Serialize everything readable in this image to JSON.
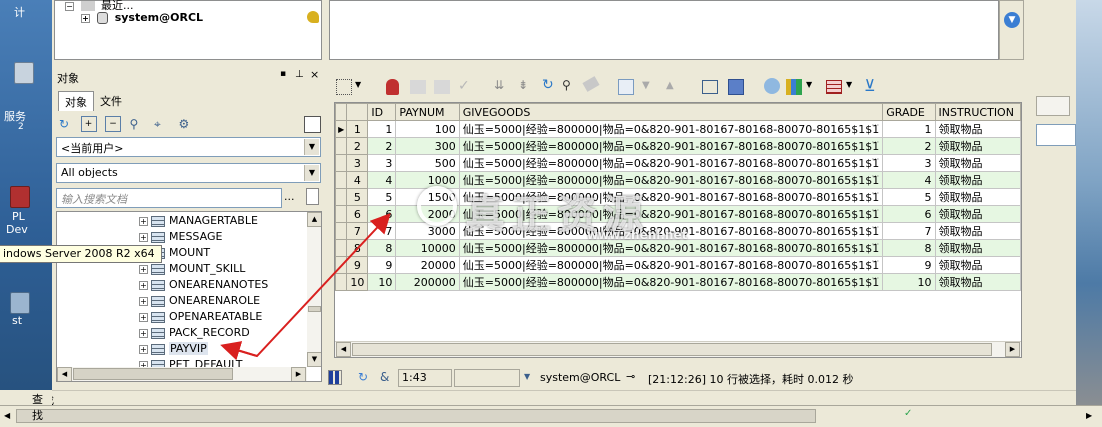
{
  "desktop": {
    "label_top": "计",
    "label_services": "服务",
    "label_services_sub": "2",
    "label_pl": "PL",
    "label_dev": "Dev",
    "label_st": "st"
  },
  "top_tree": {
    "recent_label": "最近...",
    "session_label": "system@ORCL"
  },
  "object_panel": {
    "title": "对象",
    "tab_objects": "对象",
    "tab_files": "文件",
    "user_combo": "<当前用户>",
    "type_combo": "All objects",
    "search_placeholder": "输入搜索文档",
    "search_more": "...",
    "tree_items": [
      "MANAGERTABLE",
      "MESSAGE",
      "MOUNT",
      "MOUNT_SKILL",
      "ONEARENANOTES",
      "ONEARENAROLE",
      "OPENAREATABLE",
      "PACK_RECORD",
      "PAYVIP",
      "PET_DEFAULT"
    ]
  },
  "tooltip": "indows Server 2008 R2 x64",
  "grid": {
    "headers": [
      "ID",
      "PAYNUM",
      "GIVEGOODS",
      "GRADE",
      "INSTRUCTION"
    ],
    "rows": [
      {
        "n": "1",
        "id": "1",
        "paynum": "100",
        "givegoods": "仙玉=5000|经验=800000|物品=0&820-901-80167-80168-80070-80165$1$1",
        "grade": "1",
        "instruction": "领取物品"
      },
      {
        "n": "2",
        "id": "2",
        "paynum": "300",
        "givegoods": "仙玉=5000|经验=800000|物品=0&820-901-80167-80168-80070-80165$1$1",
        "grade": "2",
        "instruction": "领取物品"
      },
      {
        "n": "3",
        "id": "3",
        "paynum": "500",
        "givegoods": "仙玉=5000|经验=800000|物品=0&820-901-80167-80168-80070-80165$1$1",
        "grade": "3",
        "instruction": "领取物品"
      },
      {
        "n": "4",
        "id": "4",
        "paynum": "1000",
        "givegoods": "仙玉=5000|经验=800000|物品=0&820-901-80167-80168-80070-80165$1$1",
        "grade": "4",
        "instruction": "领取物品"
      },
      {
        "n": "5",
        "id": "5",
        "paynum": "1500",
        "givegoods": "仙玉=5000|经验=800000|物品=0&820-901-80167-80168-80070-80165$1$1",
        "grade": "5",
        "instruction": "领取物品"
      },
      {
        "n": "6",
        "id": "6",
        "paynum": "2000",
        "givegoods": "仙玉=5000|经验=800000|物品=0&820-901-80167-80168-80070-80165$1$1",
        "grade": "6",
        "instruction": "领取物品"
      },
      {
        "n": "7",
        "id": "7",
        "paynum": "3000",
        "givegoods": "仙玉=5000|经验=800000|物品=0&820-901-80167-80168-80070-80165$1$1",
        "grade": "7",
        "instruction": "领取物品"
      },
      {
        "n": "8",
        "id": "8",
        "paynum": "10000",
        "givegoods": "仙玉=5000|经验=800000|物品=0&820-901-80167-80168-80070-80165$1$1",
        "grade": "8",
        "instruction": "领取物品"
      },
      {
        "n": "9",
        "id": "9",
        "paynum": "20000",
        "givegoods": "仙玉=5000|经验=800000|物品=0&820-901-80167-80168-80070-80165$1$1",
        "grade": "9",
        "instruction": "领取物品"
      },
      {
        "n": "10",
        "id": "10",
        "paynum": "200000",
        "givegoods": "仙玉=5000|经验=800000|物品=0&820-901-80167-80168-80070-80165$1$1",
        "grade": "10",
        "instruction": "领取物品"
      }
    ],
    "more_glyph": "···"
  },
  "status": {
    "position": "1:43",
    "connection": "system@ORCL",
    "message": "[21:12:26]  10 行被选择，耗时 0.012 秒"
  },
  "find_bar": {
    "label": "查找"
  },
  "watermark": {
    "brand": "真正资源",
    "url": "www.zhenl.net"
  },
  "colors": {
    "window_bg": "#ece9d8",
    "alt_row": "#e6f7e2",
    "arrow": "#d9201f"
  }
}
